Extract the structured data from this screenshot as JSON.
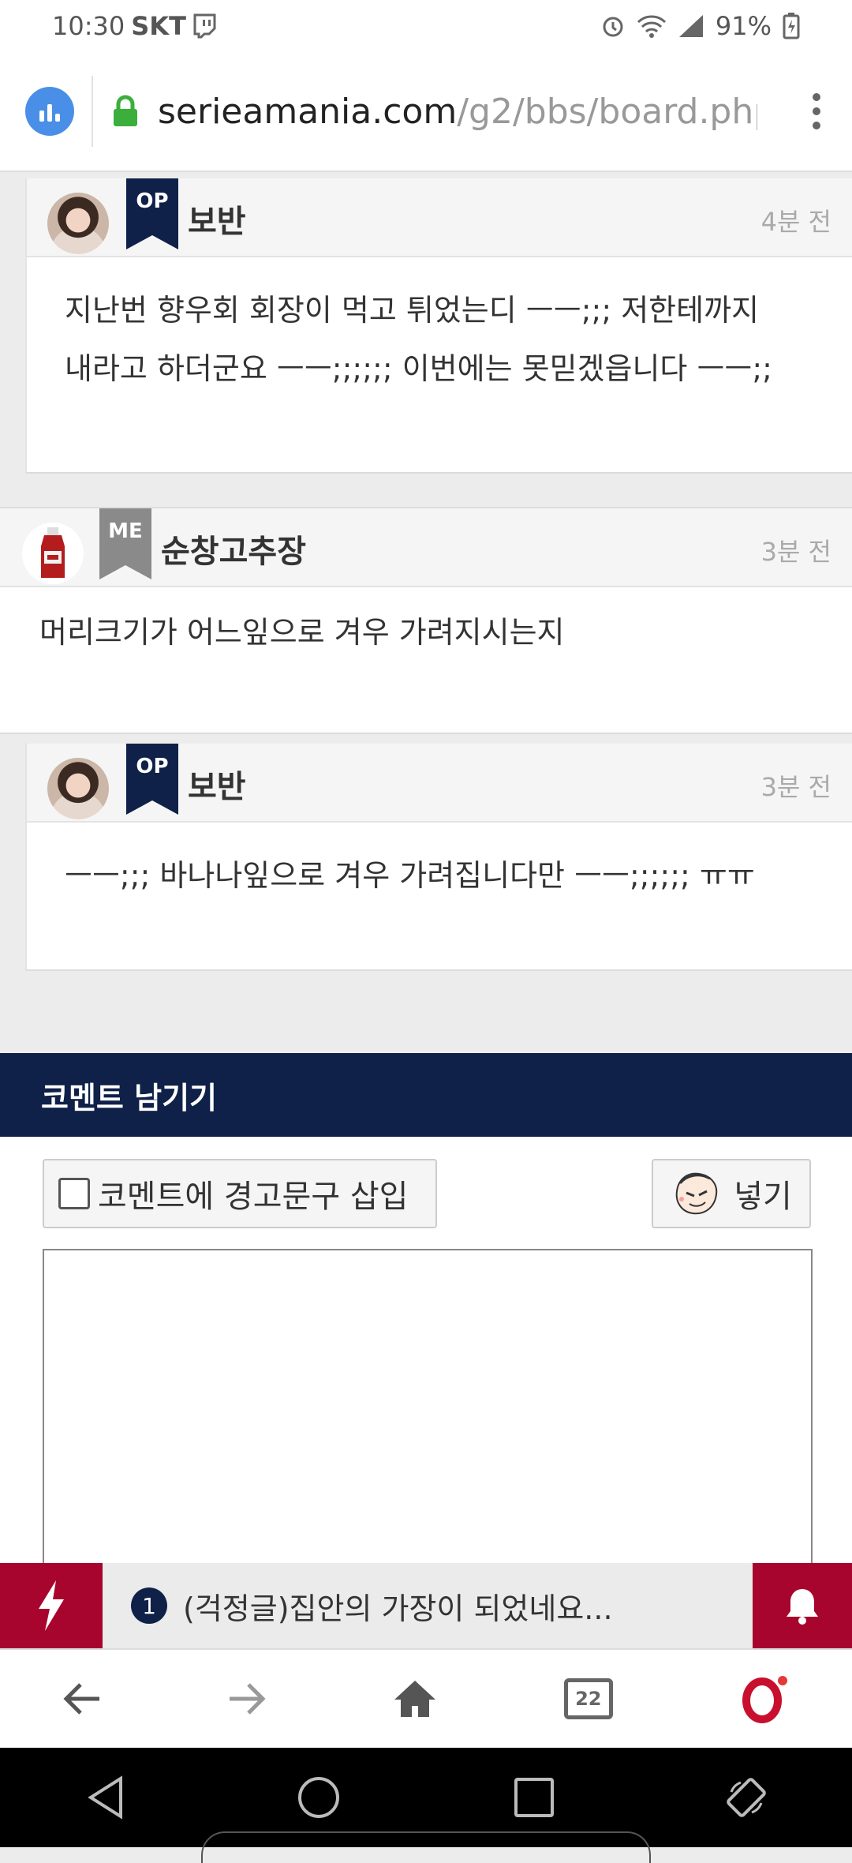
{
  "status_bar": {
    "time": "10:30",
    "carrier": "SKT",
    "battery": "91%"
  },
  "browser": {
    "url_host": "serieamania.com",
    "url_path": "/g2/bbs/board.php"
  },
  "comments": [
    {
      "badge": "OP",
      "author": "보반",
      "time": "4분 전",
      "lines": [
        "지난번 향우회 회장이 먹고 튀었는디 ㅡㅡ;;; 저한테까지",
        "내라고 하더군요 ㅡㅡ;;;;;; 이번에는 못믿겠읍니다 ㅡㅡ;;"
      ]
    },
    {
      "badge": "ME",
      "author": "순창고추장",
      "time": "3분 전",
      "lines": [
        "머리크기가 어느잎으로 겨우 가려지시는지"
      ]
    },
    {
      "badge": "OP",
      "author": "보반",
      "time": "3분 전",
      "lines": [
        "ㅡㅡ;;; 바나나잎으로 겨우 가려집니다만 ㅡㅡ;;;;;; ㅠㅠ"
      ]
    }
  ],
  "comment_form": {
    "title": "코멘트 남기기",
    "warning_checkbox_label": "코멘트에 경고문구 삽입",
    "warning_checked": false,
    "insert_button": "넣기",
    "comment_text": ""
  },
  "notice": {
    "number": "1",
    "text": "(걱정글)집안의 가장이 되었네요..."
  },
  "browser_nav": {
    "tab_count": "22"
  },
  "colors": {
    "navy": "#0f2148",
    "crimson": "#a8052e",
    "me_badge": "#8a8a8a"
  }
}
